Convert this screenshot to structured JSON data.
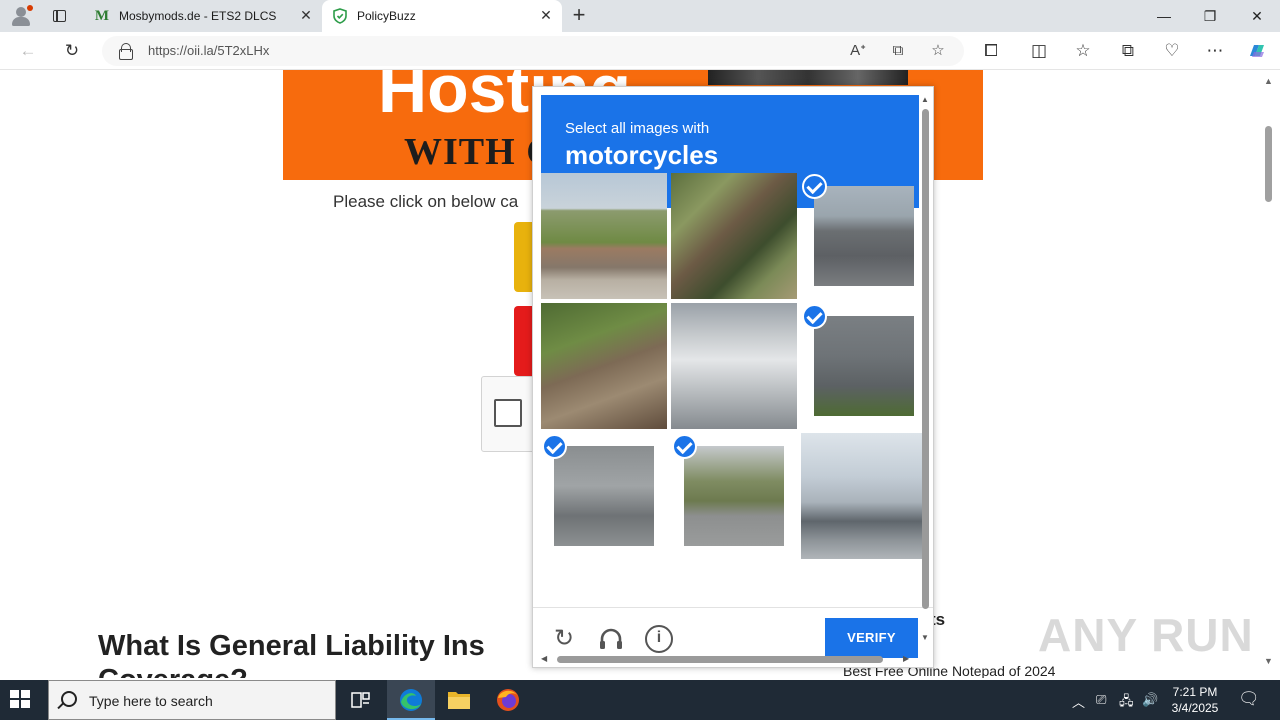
{
  "browser": {
    "tabs": [
      {
        "title": "Mosbymods.de - ETS2 DLCS",
        "favicon": "M"
      },
      {
        "title": "PolicyBuzz",
        "favicon": "shield"
      }
    ],
    "address": {
      "url": "https://oii.la/5T2xLHx"
    }
  },
  "page": {
    "banner_top": "Hosting",
    "banner_sub": "WITH C",
    "instruction": "Please click on below ca",
    "article_heading_1": "What Is General Liability Ins",
    "article_heading_2": "Coverage?",
    "sidebar_heading": "ts",
    "sidebar_link": "Best Free Online Notepad of 2024"
  },
  "captcha": {
    "prompt": "Select all images with",
    "target": "motorcycles",
    "tiles": [
      {
        "id": 1,
        "selected": false,
        "desc": "rural-road"
      },
      {
        "id": 2,
        "selected": false,
        "desc": "tree-park"
      },
      {
        "id": 3,
        "selected": true,
        "desc": "motorcycles-highway"
      },
      {
        "id": 4,
        "selected": false,
        "desc": "iron-fence"
      },
      {
        "id": 5,
        "selected": false,
        "desc": "bus-street"
      },
      {
        "id": 6,
        "selected": true,
        "desc": "motorcycle-rider"
      },
      {
        "id": 7,
        "selected": true,
        "desc": "motorcycle-red"
      },
      {
        "id": 8,
        "selected": true,
        "desc": "motorcycle-street"
      },
      {
        "id": 9,
        "selected": false,
        "desc": "building-sky"
      }
    ],
    "verify_label": "VERIFY",
    "accent_color": "#1a73e8"
  },
  "taskbar": {
    "search_placeholder": "Type here to search",
    "time": "7:21 PM",
    "date": "3/4/2025"
  },
  "watermark": "ANY RUN"
}
